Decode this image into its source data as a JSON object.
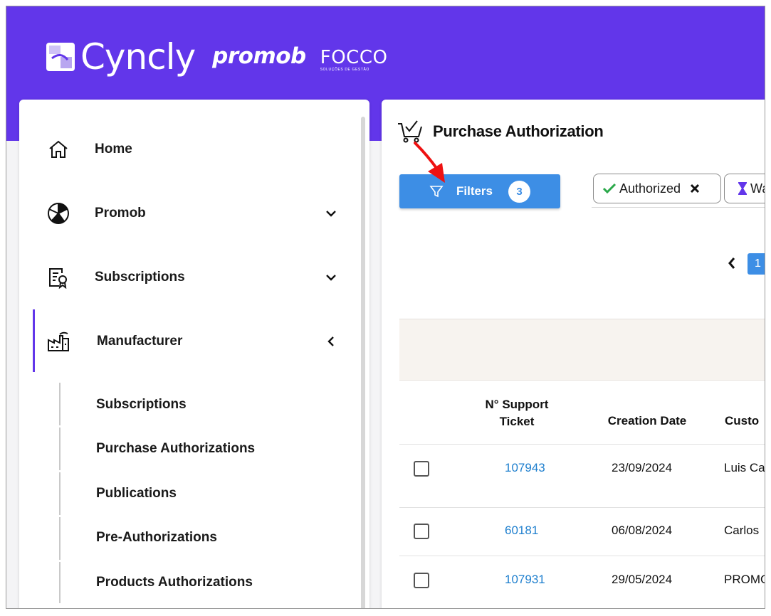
{
  "brand": {
    "cyncly": "Cyncly",
    "promob": "promob",
    "focco": "FOCCO",
    "focco_tagline": "SOLUÇÕES DE GESTÃO"
  },
  "sidebar": {
    "items": [
      {
        "label": "Home",
        "icon": "home-icon"
      },
      {
        "label": "Promob",
        "icon": "promob-icon",
        "chevron": "chevron-down-icon"
      },
      {
        "label": "Subscriptions",
        "icon": "subscription-certificate-icon",
        "chevron": "chevron-down-icon"
      },
      {
        "label": "Manufacturer",
        "icon": "factory-icon",
        "chevron": "chevron-left-icon"
      }
    ],
    "subitems": [
      {
        "label": "Subscriptions"
      },
      {
        "label": "Purchase Authorizations"
      },
      {
        "label": "Publications"
      },
      {
        "label": "Pre-Authorizations"
      },
      {
        "label": "Products Authorizations"
      }
    ]
  },
  "main": {
    "title": "Purchase Authorization",
    "filters_label": "Filters",
    "filters_count": "3",
    "chips": [
      {
        "label": "Authorized",
        "icon": "check-icon"
      },
      {
        "label": "Wa",
        "icon": "hourglass-icon"
      }
    ],
    "pager": {
      "current": "1"
    },
    "columns": [
      "N° Support Ticket",
      "Creation Date",
      "Custo"
    ],
    "rows": [
      {
        "ticket": "107943",
        "date": "23/09/2024",
        "customer": "Luis Ca"
      },
      {
        "ticket": "60181",
        "date": "06/08/2024",
        "customer": "Carlos"
      },
      {
        "ticket": "107931",
        "date": "29/05/2024",
        "customer": "PROMO"
      }
    ]
  },
  "colors": {
    "brand_purple": "#6236ea",
    "primary_blue": "#3d8ee5",
    "link_blue": "#1e7fce",
    "annotation_red": "#ee1111"
  }
}
